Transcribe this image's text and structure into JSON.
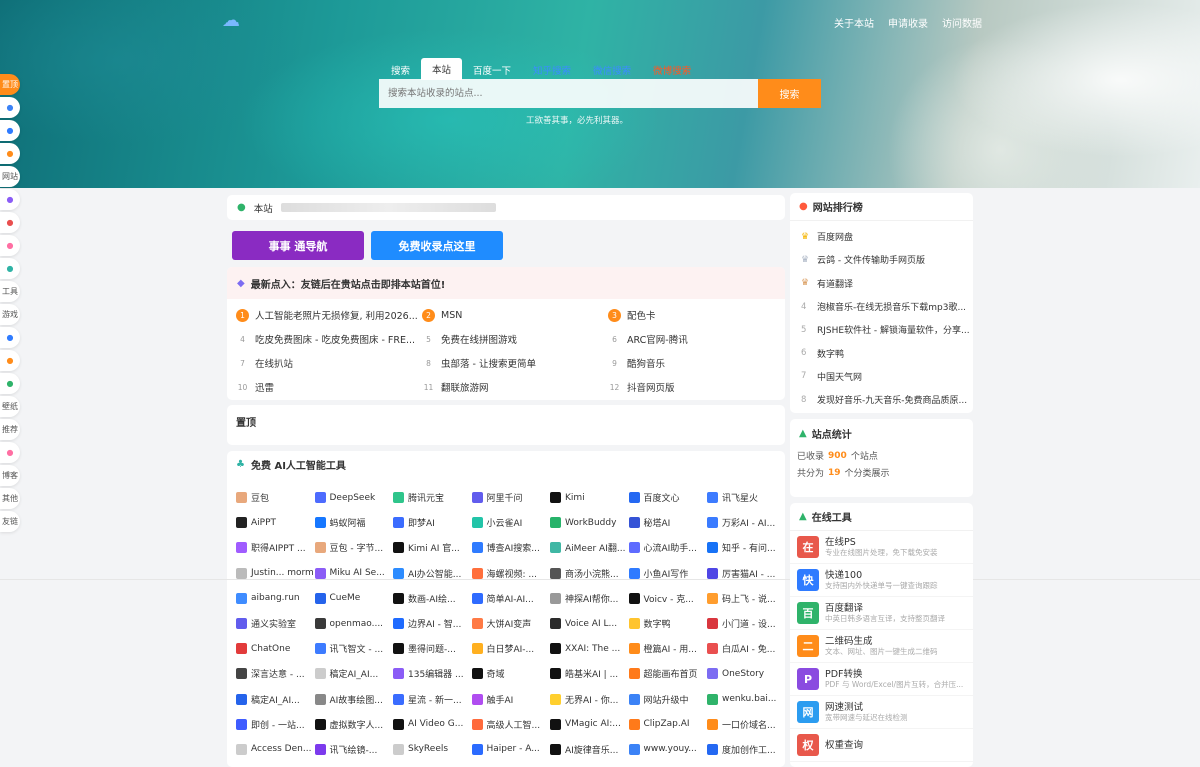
{
  "header": {
    "links": [
      "关于本站",
      "申请收录",
      "访问数据"
    ]
  },
  "search": {
    "tabs": [
      {
        "label": "搜索",
        "style": "plain"
      },
      {
        "label": "本站",
        "style": "active"
      },
      {
        "label": "百度一下",
        "style": "plain"
      },
      {
        "label": "知乎搜索",
        "style": "blue"
      },
      {
        "label": "微信搜索",
        "style": "blue"
      },
      {
        "label": "微博搜索",
        "style": "red"
      }
    ],
    "placeholder": "搜索本站收录的站点...",
    "button": "搜索",
    "hint": "工欲善其事，必先利其器。"
  },
  "leftnav": [
    "置顶",
    "",
    "",
    "",
    "网站",
    "",
    "",
    "",
    "",
    "工具",
    "游戏",
    "",
    "",
    "",
    "壁纸",
    "推荐",
    "",
    "博客",
    "其他",
    "友链"
  ],
  "notice": {
    "prefix": "本站"
  },
  "buttons": {
    "purple": "事事 通导航",
    "blue": "免费收录点这里"
  },
  "hot": {
    "title": "最新点入：友链后在贵站点击即排本站首位!",
    "items": [
      {
        "n": "1",
        "t": "人工智能老照片无损修复, 利用2026..."
      },
      {
        "n": "2",
        "t": "MSN"
      },
      {
        "n": "3",
        "t": "配色卡"
      },
      {
        "n": "4",
        "t": "吃皮免费图床 - 吃皮免费图床 - FRE..."
      },
      {
        "n": "5",
        "t": "免费在线拼图游戏"
      },
      {
        "n": "6",
        "t": "ARC官网-腾讯"
      },
      {
        "n": "7",
        "t": "在线扒站"
      },
      {
        "n": "8",
        "t": "虫部落 - 让搜索更简单"
      },
      {
        "n": "9",
        "t": "酷狗音乐"
      },
      {
        "n": "10",
        "t": "迅雷"
      },
      {
        "n": "11",
        "t": "翻联旅游网"
      },
      {
        "n": "12",
        "t": "抖音网页版"
      }
    ]
  },
  "pinned": {
    "title": "置顶"
  },
  "ai": {
    "title": "免费 AI人工智能工具",
    "items": [
      {
        "t": "豆包",
        "c": "#e8a87c"
      },
      {
        "t": "DeepSeek",
        "c": "#4d6bfe"
      },
      {
        "t": "腾讯元宝",
        "c": "#2fc58b"
      },
      {
        "t": "阿里千问",
        "c": "#615ced"
      },
      {
        "t": "Kimi",
        "c": "#111111"
      },
      {
        "t": "百度文心",
        "c": "#2468f2"
      },
      {
        "t": "讯飞星火",
        "c": "#3d7bff"
      },
      {
        "t": "AiPPT",
        "c": "#222222"
      },
      {
        "t": "蚂蚁阿福",
        "c": "#1677ff"
      },
      {
        "t": "即梦AI",
        "c": "#3b6cff"
      },
      {
        "t": "小云雀AI",
        "c": "#22c4a8"
      },
      {
        "t": "WorkBuddy",
        "c": "#27b36a"
      },
      {
        "t": "秘塔AI",
        "c": "#3553d6"
      },
      {
        "t": "万彩AI - AI...",
        "c": "#3a7bff"
      },
      {
        "t": "职得AIPPT ...",
        "c": "#a05cff"
      },
      {
        "t": "豆包 - 字节...",
        "c": "#e8a87c"
      },
      {
        "t": "Kimi AI 官...",
        "c": "#111111"
      },
      {
        "t": "博查AI搜索...",
        "c": "#2f7bff"
      },
      {
        "t": "AiMeer AI翻...",
        "c": "#3fb7a4"
      },
      {
        "t": "心流AI助手...",
        "c": "#5e6bff"
      },
      {
        "t": "知乎 - 有问...",
        "c": "#1772f6"
      },
      {
        "t": "Justin... morm",
        "c": "#bbbbbb"
      },
      {
        "t": "Miku AI Se...",
        "c": "#8b5cf6"
      },
      {
        "t": "AI办公智能...",
        "c": "#2d8cff"
      },
      {
        "t": "海螺视频: ...",
        "c": "#ff6f3c"
      },
      {
        "t": "商汤小浣熊...",
        "c": "#555555"
      },
      {
        "t": "小鱼AI写作",
        "c": "#2f7bff"
      },
      {
        "t": "厉害猫AI - ...",
        "c": "#4f46e5"
      },
      {
        "t": "aibang.run",
        "c": "#3f8cff"
      },
      {
        "t": "CueMe",
        "c": "#2563eb"
      },
      {
        "t": "数画-AI绘...",
        "c": "#111111"
      },
      {
        "t": "简单AI-AI...",
        "c": "#2f6bff"
      },
      {
        "t": "神探AI帮你...",
        "c": "#999999"
      },
      {
        "t": "Voicv - 克...",
        "c": "#111111"
      },
      {
        "t": "码上飞 - 说...",
        "c": "#ff9d2e"
      },
      {
        "t": "通义实验室",
        "c": "#615ced"
      },
      {
        "t": "openmao....",
        "c": "#3a3a3a"
      },
      {
        "t": "边界AI - 智...",
        "c": "#1f6bff"
      },
      {
        "t": "大饼AI变声",
        "c": "#ff7a45"
      },
      {
        "t": "Voice AI L...",
        "c": "#2b2b2b"
      },
      {
        "t": "数字鸭",
        "c": "#ffc42e"
      },
      {
        "t": "小门道 - 设...",
        "c": "#d9363e"
      },
      {
        "t": "ChatOne",
        "c": "#e23b3b"
      },
      {
        "t": "讯飞智文 - ...",
        "c": "#3d7bff"
      },
      {
        "t": "墨得问题-...",
        "c": "#111111"
      },
      {
        "t": "白日梦AI-...",
        "c": "#ffb020"
      },
      {
        "t": "XXAI: The ...",
        "c": "#111111"
      },
      {
        "t": "橙篇AI - 用...",
        "c": "#ff8c1a"
      },
      {
        "t": "白瓜AI - 免...",
        "c": "#e94f4f"
      },
      {
        "t": "深言达意 - ...",
        "c": "#444444"
      },
      {
        "t": "稿定AI_AI...",
        "c": "#cccccc"
      },
      {
        "t": "135编辑器 ...",
        "c": "#8b5cf6"
      },
      {
        "t": "奇域",
        "c": "#111111"
      },
      {
        "t": "皓基米AI | ...",
        "c": "#111111"
      },
      {
        "t": "超能画布首页",
        "c": "#ff7a1a"
      },
      {
        "t": "OneStory",
        "c": "#7c6cf2"
      },
      {
        "t": "稿定AI_AI...",
        "c": "#2563eb"
      },
      {
        "t": "AI故事绘图...",
        "c": "#888888"
      },
      {
        "t": "星流 - 新一...",
        "c": "#3a6cff"
      },
      {
        "t": "触手AI",
        "c": "#b04df0"
      },
      {
        "t": "无界AI - 你...",
        "c": "#ffcf2e"
      },
      {
        "t": "网站升级中",
        "c": "#3b82f6"
      },
      {
        "t": "wenku.bai...",
        "c": "#2fb36a"
      },
      {
        "t": "即创 - 一站...",
        "c": "#3f5cff"
      },
      {
        "t": "虚拟数字人...",
        "c": "#111111"
      },
      {
        "t": "AI Video G...",
        "c": "#111111"
      },
      {
        "t": "高级人工智...",
        "c": "#ff6a3c"
      },
      {
        "t": "VMagic AI:...",
        "c": "#111111"
      },
      {
        "t": "ClipZap.AI",
        "c": "#ff7a1a"
      },
      {
        "t": "一口价域名...",
        "c": "#ff8c1a"
      },
      {
        "t": "Access Den...",
        "c": "#cccccc"
      },
      {
        "t": "讯飞绘镜-...",
        "c": "#7c3aed"
      },
      {
        "t": "SkyReels",
        "c": "#cccccc"
      },
      {
        "t": "Haiper - A...",
        "c": "#2b6bff"
      },
      {
        "t": "AI旋律音乐...",
        "c": "#111111"
      },
      {
        "t": "www.youy...",
        "c": "#3b82f6"
      },
      {
        "t": "度加创作工...",
        "c": "#2468f2"
      }
    ]
  },
  "rank": {
    "title": "网站排行榜",
    "items": [
      {
        "n": "1",
        "t": "百度网盘",
        "crown": "#f5b400"
      },
      {
        "n": "2",
        "t": "云鸽 - 文件传输助手网页版",
        "crown": "#aab4c4"
      },
      {
        "n": "3",
        "t": "有道翻译",
        "crown": "#d99a5b"
      },
      {
        "n": "4",
        "t": "泡椒音乐-在线无损音乐下载mp3歌..."
      },
      {
        "n": "5",
        "t": "RJSHE软件社 - 解锁海量软件，分享..."
      },
      {
        "n": "6",
        "t": "数字鸭"
      },
      {
        "n": "7",
        "t": "中国天气网"
      },
      {
        "n": "8",
        "t": "发现好音乐-九天音乐-免费商品质原..."
      }
    ]
  },
  "stats": {
    "title": "站点统计",
    "line1_pre": "已收录",
    "line1_num": "900",
    "line1_post": "个站点",
    "line2_pre": "共分为",
    "line2_num": "19",
    "line2_post": "个分类展示"
  },
  "tools": {
    "title": "在线工具",
    "items": [
      {
        "icon": "在",
        "c": "#e8584b",
        "t": "在线PS",
        "d": "专业在线图片处理，免下载免安装"
      },
      {
        "icon": "快",
        "c": "#2f7bff",
        "t": "快递100",
        "d": "支持国内外快递单号一键查询跟踪"
      },
      {
        "icon": "百",
        "c": "#2fb36a",
        "t": "百度翻译",
        "d": "中英日韩多语言互译，支持整页翻译"
      },
      {
        "icon": "二",
        "c": "#ff8c1a",
        "t": "二维码生成",
        "d": "文本、网址、图片一键生成二维码"
      },
      {
        "icon": "P",
        "c": "#8a4be0",
        "t": "PDF转换",
        "d": "PDF 与 Word/Excel/图片互转，合并压..."
      },
      {
        "icon": "网",
        "c": "#2b9cf0",
        "t": "网速测试",
        "d": "宽带网速与延迟在线检测"
      },
      {
        "icon": "权",
        "c": "#e8584b",
        "t": "权重查询",
        "d": ""
      }
    ]
  }
}
